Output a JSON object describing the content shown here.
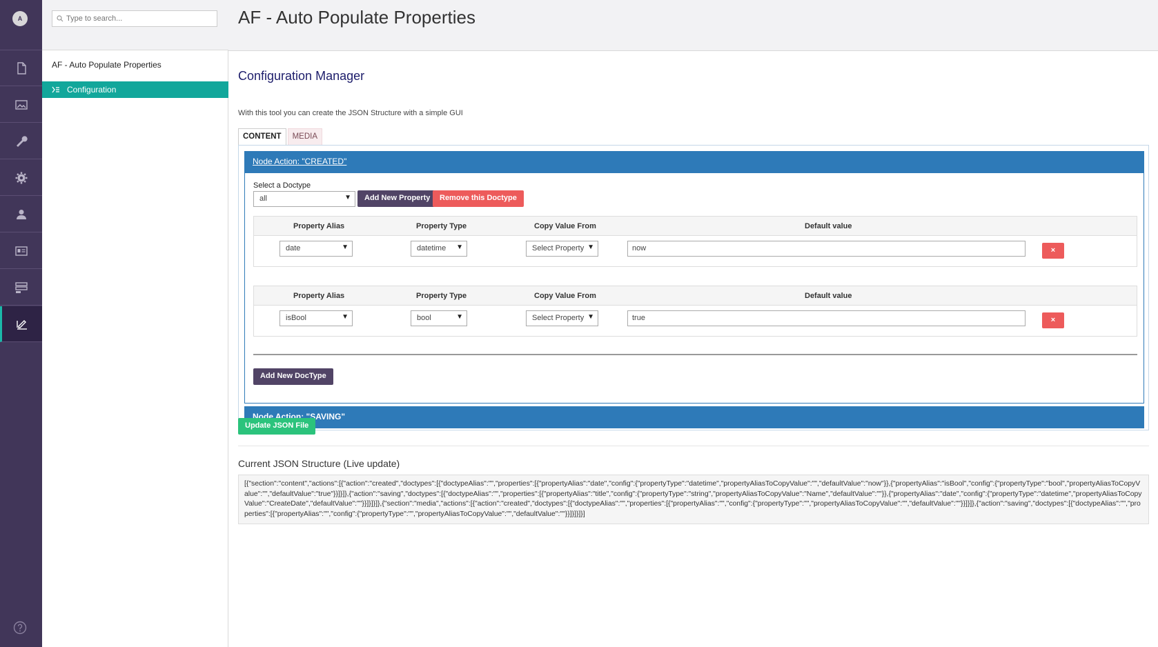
{
  "rail": {
    "avatar_initial": "A",
    "items": [
      {
        "name": "content",
        "icon": "document-icon"
      },
      {
        "name": "media",
        "icon": "image-icon"
      },
      {
        "name": "settings",
        "icon": "wrench-icon"
      },
      {
        "name": "developer",
        "icon": "gear-icon"
      },
      {
        "name": "users",
        "icon": "user-icon"
      },
      {
        "name": "members",
        "icon": "id-card-icon"
      },
      {
        "name": "forms",
        "icon": "forms-icon"
      },
      {
        "name": "auto-populate",
        "icon": "edit-icon"
      }
    ],
    "help_icon": "help-icon"
  },
  "tree": {
    "search_placeholder": "Type to search...",
    "root_label": "AF - Auto Populate Properties",
    "selected_node": "Configuration"
  },
  "header": {
    "title": "AF - Auto Populate Properties"
  },
  "main": {
    "title": "Configuration Manager",
    "intro": "With this tool you can create the JSON Structure with a simple GUI",
    "tabs": [
      {
        "label": "CONTENT",
        "active": true
      },
      {
        "label": "MEDIA",
        "active": false
      }
    ],
    "actions": [
      {
        "label": "Node Action: \"CREATED\""
      },
      {
        "label": "Node Action: \"SAVING\""
      }
    ],
    "doctype_label": "Select a Doctype",
    "doctype_value": "all",
    "add_property_label": "Add New Property",
    "remove_doctype_label": "Remove this Doctype",
    "columns": [
      "Property Alias",
      "Property Type",
      "Copy Value From",
      "Default value"
    ],
    "properties": [
      {
        "alias": "date",
        "type": "datetime",
        "copy_from": "Select Property",
        "default_value": "now"
      },
      {
        "alias": "isBool",
        "type": "bool",
        "copy_from": "Select Property",
        "default_value": "true"
      }
    ],
    "delete_label": "×",
    "add_doctype_label": "Add New DocType",
    "update_button_label": "Update JSON File",
    "json_title": "Current JSON Structure (Live update)",
    "json_text": "[{\"section\":\"content\",\"actions\":[{\"action\":\"created\",\"doctypes\":[{\"doctypeAlias\":\"\",\"properties\":[{\"propertyAlias\":\"date\",\"config\":{\"propertyType\":\"datetime\",\"propertyAliasToCopyValue\":\"\",\"defaultValue\":\"now\"}},{\"propertyAlias\":\"isBool\",\"config\":{\"propertyType\":\"bool\",\"propertyAliasToCopyValue\":\"\",\"defaultValue\":\"true\"}}]}]},{\"action\":\"saving\",\"doctypes\":[{\"doctypeAlias\":\"\",\"properties\":[{\"propertyAlias\":\"title\",\"config\":{\"propertyType\":\"string\",\"propertyAliasToCopyValue\":\"Name\",\"defaultValue\":\"\"}},{\"propertyAlias\":\"date\",\"config\":{\"propertyType\":\"datetime\",\"propertyAliasToCopyValue\":\"CreateDate\",\"defaultValue\":\"\"}}]}]}]},{\"section\":\"media\",\"actions\":[{\"action\":\"created\",\"doctypes\":[{\"doctypeAlias\":\"\",\"properties\":[{\"propertyAlias\":\"\",\"config\":{\"propertyType\":\"\",\"propertyAliasToCopyValue\":\"\",\"defaultValue\":\"\"}}]}]},{\"action\":\"saving\",\"doctypes\":[{\"doctypeAlias\":\"\",\"properties\":[{\"propertyAlias\":\"\",\"config\":{\"propertyType\":\"\",\"propertyAliasToCopyValue\":\"\",\"defaultValue\":\"\"}}]}]}]}]"
  },
  "colors": {
    "rail_bg": "#413659",
    "accent_teal": "#12a79b",
    "action_blue": "#2e7ab8",
    "danger_red": "#ed5b5b",
    "button_purple": "#514466",
    "success_green": "#2bc37c",
    "title_navy": "#1d1d6b"
  }
}
